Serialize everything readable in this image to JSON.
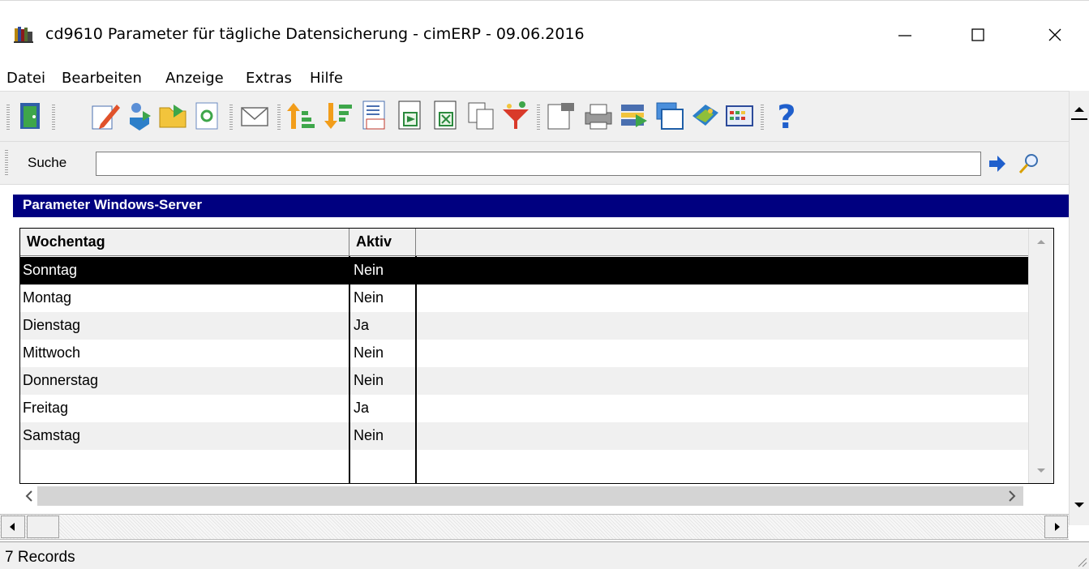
{
  "window": {
    "title": "cd9610 Parameter für tägliche Datensicherung - cimERP - 09.06.2016",
    "app_icon": "books-app-icon"
  },
  "menu": [
    "Datei",
    "Bearbeiten",
    "Anzeige",
    "Extras",
    "Hilfe"
  ],
  "toolbar": {
    "icons": [
      "exit-door-icon",
      "edit-pencil-icon",
      "import-icon",
      "open-folder-icon",
      "refresh-icon",
      "mail-icon",
      "sort-ascending-icon",
      "sort-descending-icon",
      "calculator-icon",
      "export-icon",
      "excel-icon",
      "copy-icon",
      "filter-icon",
      "properties-icon",
      "print-icon",
      "transfer-icon",
      "windows-icon",
      "book-icon",
      "grid-icon",
      "help-icon"
    ]
  },
  "search": {
    "label": "Suche",
    "value": ""
  },
  "section": {
    "title": "Parameter Windows-Server"
  },
  "grid": {
    "columns": [
      "Wochentag",
      "Aktiv"
    ],
    "rows": [
      {
        "day": "Sonntag",
        "active": "Nein"
      },
      {
        "day": "Montag",
        "active": "Nein"
      },
      {
        "day": "Dienstag",
        "active": "Ja"
      },
      {
        "day": "Mittwoch",
        "active": "Nein"
      },
      {
        "day": "Donnerstag",
        "active": "Nein"
      },
      {
        "day": "Freitag",
        "active": "Ja"
      },
      {
        "day": "Samstag",
        "active": "Nein"
      }
    ],
    "selected_index": 0
  },
  "status": {
    "text": "7 Records"
  },
  "colors": {
    "section_bg": "#000080",
    "selection_bg": "#000000",
    "alt_row": "#f0f0f0"
  }
}
